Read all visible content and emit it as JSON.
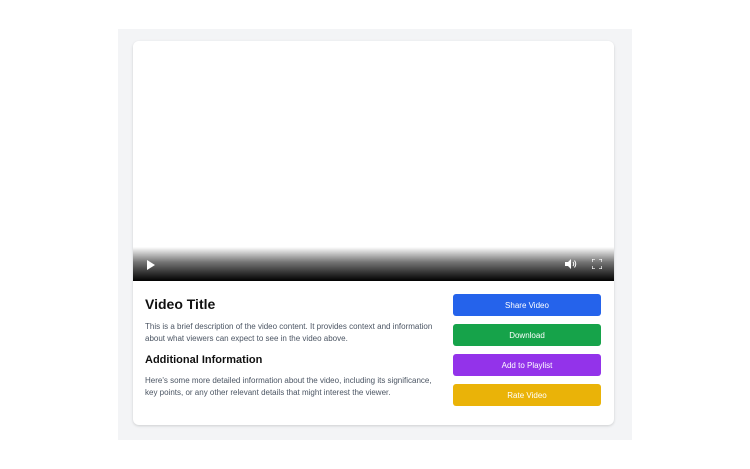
{
  "video": {
    "controls": {
      "play_icon": "play-icon",
      "volume_icon": "volume-icon",
      "fullscreen_icon": "fullscreen-icon"
    }
  },
  "content": {
    "title": "Video Title",
    "description": "This is a brief description of the video content. It provides context and information about what viewers can expect to see in the video above.",
    "additional_title": "Additional Information",
    "additional_text": "Here's some more detailed information about the video, including its significance, key points, or any other relevant details that might interest the viewer."
  },
  "actions": [
    {
      "label": "Share Video",
      "color": "#2563eb"
    },
    {
      "label": "Download",
      "color": "#16a34a"
    },
    {
      "label": "Add to Playlist",
      "color": "#9333ea"
    },
    {
      "label": "Rate Video",
      "color": "#eab308"
    }
  ]
}
